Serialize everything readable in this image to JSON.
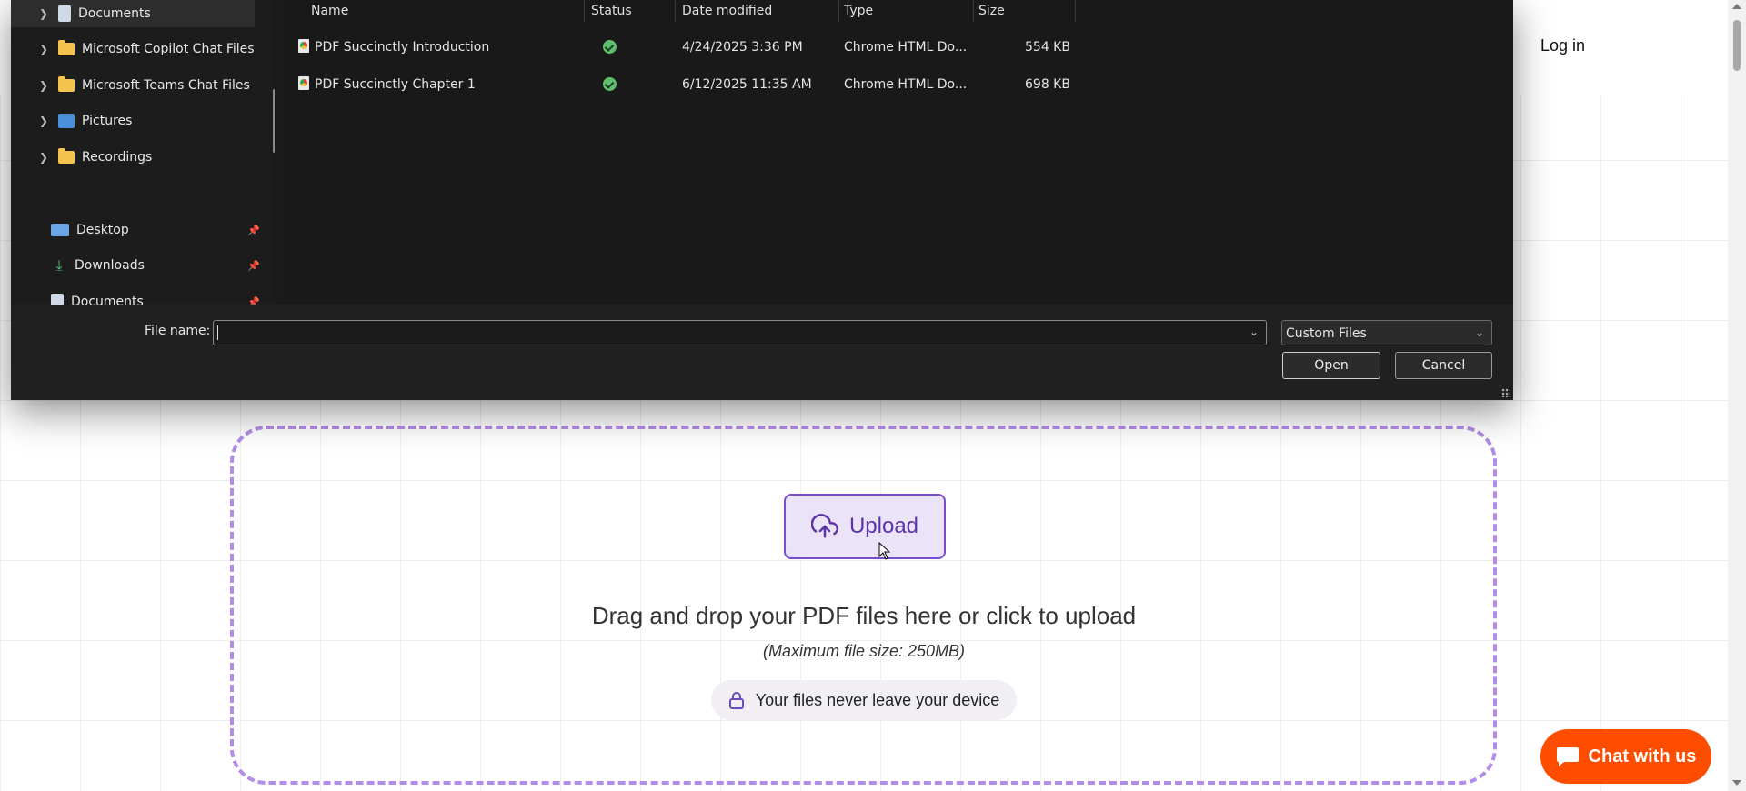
{
  "header": {
    "login_label": "Log in"
  },
  "dialog": {
    "nav_tree": [
      {
        "label": "Documents",
        "icon": "document-icon"
      },
      {
        "label": "Microsoft Copilot Chat Files",
        "icon": "folder-icon"
      },
      {
        "label": "Microsoft Teams Chat Files",
        "icon": "folder-icon"
      },
      {
        "label": "Pictures",
        "icon": "pictures-icon"
      },
      {
        "label": "Recordings",
        "icon": "folder-icon"
      }
    ],
    "quick_access": [
      {
        "label": "Desktop",
        "icon": "desktop-icon"
      },
      {
        "label": "Downloads",
        "icon": "download-icon"
      },
      {
        "label": "Documents",
        "icon": "document-icon"
      }
    ],
    "columns": [
      "Name",
      "Status",
      "Date modified",
      "Type",
      "Size"
    ],
    "files": [
      {
        "name": "PDF Succinctly Introduction",
        "status": "synced",
        "date": "4/24/2025 3:36 PM",
        "type": "Chrome HTML Do...",
        "size": "554 KB"
      },
      {
        "name": "PDF Succinctly Chapter 1",
        "status": "synced",
        "date": "6/12/2025 11:35 AM",
        "type": "Chrome HTML Do...",
        "size": "698 KB"
      }
    ],
    "file_name_label": "File name:",
    "file_name_value": "",
    "filter_value": "Custom Files",
    "open_label": "Open",
    "cancel_label": "Cancel"
  },
  "upload": {
    "button_label": "Upload",
    "drag_text": "Drag and drop your PDF files here or click to upload",
    "max_size_text": "(Maximum file size: 250MB)",
    "privacy_text": "Your files never leave your device"
  },
  "chat": {
    "label": "Chat with us"
  },
  "colors": {
    "accent": "#7c4dcb",
    "dashed_border": "#b28ce6",
    "chat": "#ff4d00"
  }
}
